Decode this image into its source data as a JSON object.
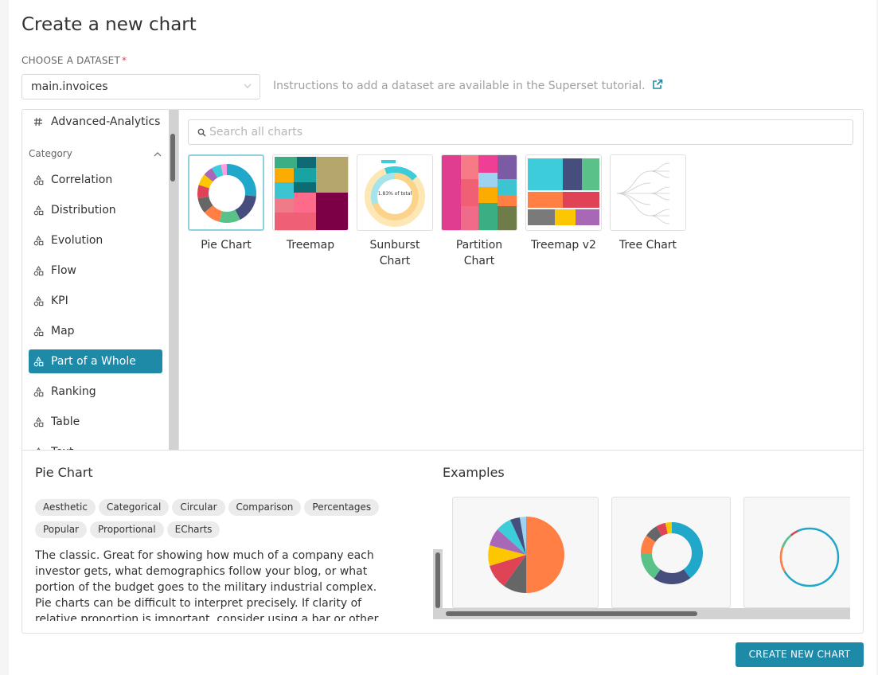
{
  "page": {
    "title": "Create a new chart"
  },
  "dataset": {
    "label": "CHOOSE A DATASET",
    "required_mark": "*",
    "value": "main.invoices",
    "help_text": "Instructions to add a dataset are available in the Superset tutorial."
  },
  "sidebar": {
    "top_item": "Advanced-Analytics",
    "category_label": "Category",
    "items": [
      {
        "label": "Correlation"
      },
      {
        "label": "Distribution"
      },
      {
        "label": "Evolution"
      },
      {
        "label": "Flow"
      },
      {
        "label": "KPI"
      },
      {
        "label": "Map"
      },
      {
        "label": "Part of a Whole",
        "active": true
      },
      {
        "label": "Ranking"
      },
      {
        "label": "Table"
      },
      {
        "label": "Text"
      }
    ]
  },
  "search": {
    "placeholder": "Search all charts"
  },
  "charts": [
    {
      "name": "Pie Chart",
      "selected": true
    },
    {
      "name": "Treemap"
    },
    {
      "name": "Sunburst Chart"
    },
    {
      "name": "Partition Chart"
    },
    {
      "name": "Treemap v2"
    },
    {
      "name": "Tree Chart"
    }
  ],
  "details": {
    "title": "Pie Chart",
    "tags": [
      "Aesthetic",
      "Categorical",
      "Circular",
      "Comparison",
      "Percentages",
      "Popular",
      "Proportional",
      "ECharts"
    ],
    "description": "The classic. Great for showing how much of a company each investor gets, what demographics follow your blog, or what portion of the budget goes to the military industrial complex. Pie charts can be difficult to interpret precisely. If clarity of relative proportion is important, consider using a bar or other chart type instead.",
    "examples_title": "Examples"
  },
  "actions": {
    "create_label": "CREATE NEW CHART"
  },
  "colors": {
    "accent": "#1f8aa8",
    "required": "#e04355"
  }
}
